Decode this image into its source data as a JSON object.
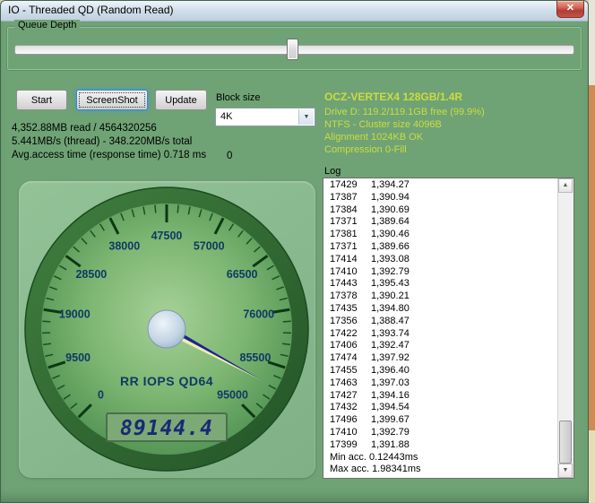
{
  "window": {
    "title": "IO - Threaded QD (Random Read)"
  },
  "icons": {
    "close": "✕",
    "combo_arrow": "▼",
    "scroll_up": "▲",
    "scroll_down": "▼"
  },
  "queue_depth": {
    "label": "Queue Depth"
  },
  "toolbar": {
    "start_label": "Start",
    "screenshot_label": "ScreenShot",
    "update_label": "Update"
  },
  "block_size": {
    "label": "Block size",
    "selected": "4K"
  },
  "drive_info": {
    "title": "OCZ-VERTEX4 128GB/1.4R",
    "lines": [
      "Drive D: 119.2/119.1GB free (99.9%)",
      "NTFS - Cluster size 4096B",
      "Alignment 1024KB OK",
      "Compression 0-Fill"
    ]
  },
  "stats": {
    "line1": "4,352.88MB read / 4564320256",
    "line2": "5.441MB/s (thread) - 348.220MB/s total",
    "line3": "Avg.access time (response time) 0.718 ms",
    "counter": "0"
  },
  "log": {
    "label": "Log",
    "entries": [
      [
        "17429",
        "1,394.27"
      ],
      [
        "17387",
        "1,390.94"
      ],
      [
        "17384",
        "1,390.69"
      ],
      [
        "17371",
        "1,389.64"
      ],
      [
        "17381",
        "1,390.46"
      ],
      [
        "17371",
        "1,389.66"
      ],
      [
        "17414",
        "1,393.08"
      ],
      [
        "17410",
        "1,392.79"
      ],
      [
        "17443",
        "1,395.43"
      ],
      [
        "17378",
        "1,390.21"
      ],
      [
        "17435",
        "1,394.80"
      ],
      [
        "17356",
        "1,388.47"
      ],
      [
        "17422",
        "1,393.74"
      ],
      [
        "17406",
        "1,392.47"
      ],
      [
        "17474",
        "1,397.92"
      ],
      [
        "17455",
        "1,396.40"
      ],
      [
        "17463",
        "1,397.03"
      ],
      [
        "17427",
        "1,394.16"
      ],
      [
        "17432",
        "1,394.54"
      ],
      [
        "17496",
        "1,399.67"
      ],
      [
        "17410",
        "1,392.79"
      ],
      [
        "17399",
        "1,391.88"
      ]
    ],
    "footer": [
      "Min acc. 0.12443ms",
      "Max acc. 1.98341ms"
    ]
  },
  "gauge": {
    "label": "RR IOPS QD64",
    "min": 0,
    "max": 95000,
    "major_step": 9500,
    "minor_step": 1900,
    "tick_labels": [
      "0",
      "9500",
      "19000",
      "28500",
      "38000",
      "47500",
      "57000",
      "66500",
      "76000",
      "85500",
      "95000"
    ],
    "value": 89144.4,
    "display": "89144.4"
  },
  "colors": {
    "window_bg": "#6fa375",
    "gauge_panel": "#8bbc90",
    "drive_text": "#cbdc41",
    "lcd_digits": "#182a74",
    "needle_navy": "#1c2490",
    "needle_yellow": "#efecb0"
  }
}
